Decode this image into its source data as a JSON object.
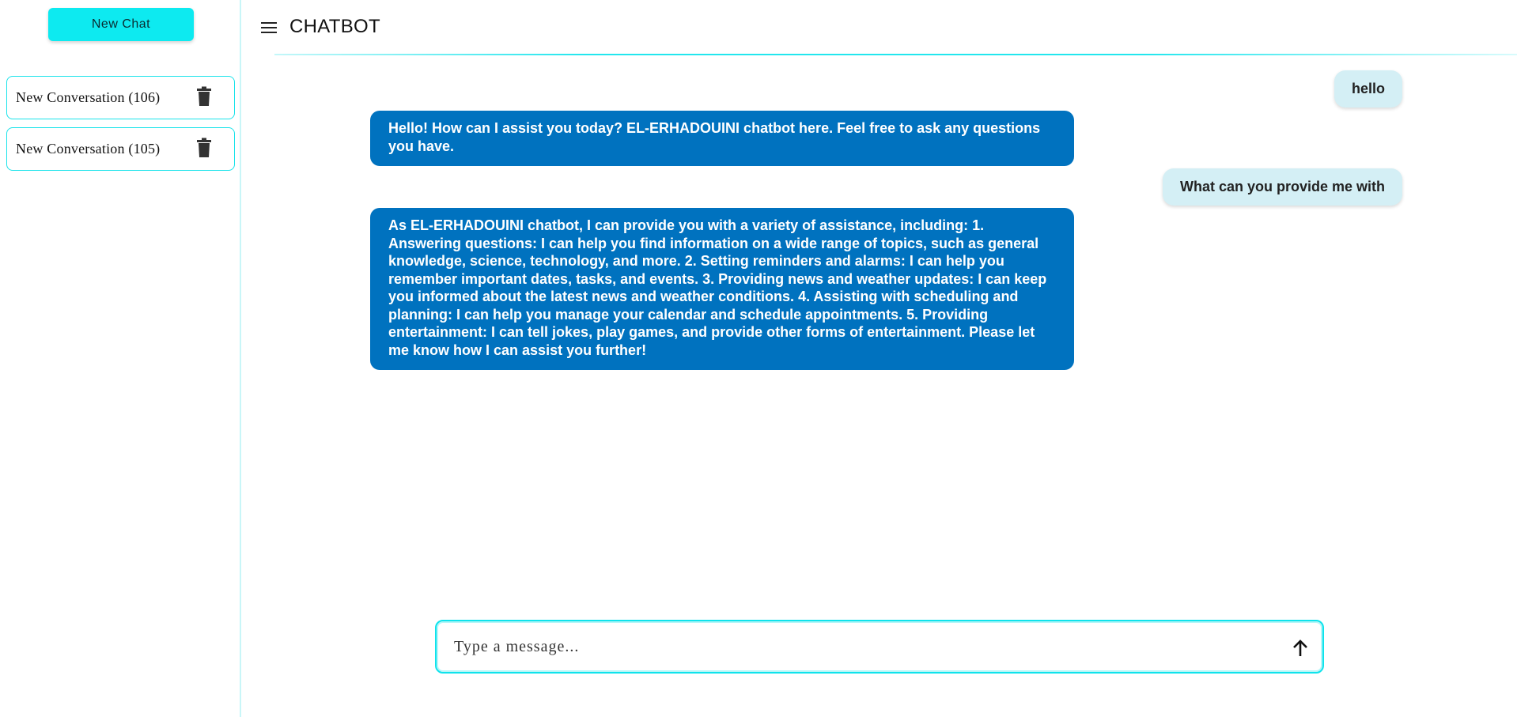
{
  "sidebar": {
    "new_chat_label": "New Chat",
    "conversations": [
      {
        "label": "New Conversation (106)"
      },
      {
        "label": "New Conversation (105)"
      }
    ]
  },
  "header": {
    "title": "CHATBOT"
  },
  "messages": [
    {
      "role": "user",
      "text": "hello"
    },
    {
      "role": "bot",
      "text": "Hello! How can I assist you today? EL-ERHADOUINI chatbot here. Feel free to ask any questions you have."
    },
    {
      "role": "user",
      "text": "What can you provide me with"
    },
    {
      "role": "bot",
      "text": "As EL-ERHADOUINI chatbot, I can provide you with a variety of assistance, including: 1. Answering questions: I can help you find information on a wide range of topics, such as general knowledge, science, technology, and more. 2. Setting reminders and alarms: I can help you remember important dates, tasks, and events. 3. Providing news and weather updates: I can keep you informed about the latest news and weather conditions. 4. Assisting with scheduling and planning: I can help you manage your calendar and schedule appointments. 5. Providing entertainment: I can tell jokes, play games, and provide other forms of entertainment. Please let me know how I can assist you further!"
    }
  ],
  "composer": {
    "placeholder": "Type a message..."
  },
  "icons": {
    "menu": "menu-icon",
    "delete": "trash-icon",
    "send": "arrow-up-icon"
  },
  "colors": {
    "accent": "#0deaf0",
    "bot_bubble": "#0072bf",
    "user_bubble": "#d4eff5"
  }
}
